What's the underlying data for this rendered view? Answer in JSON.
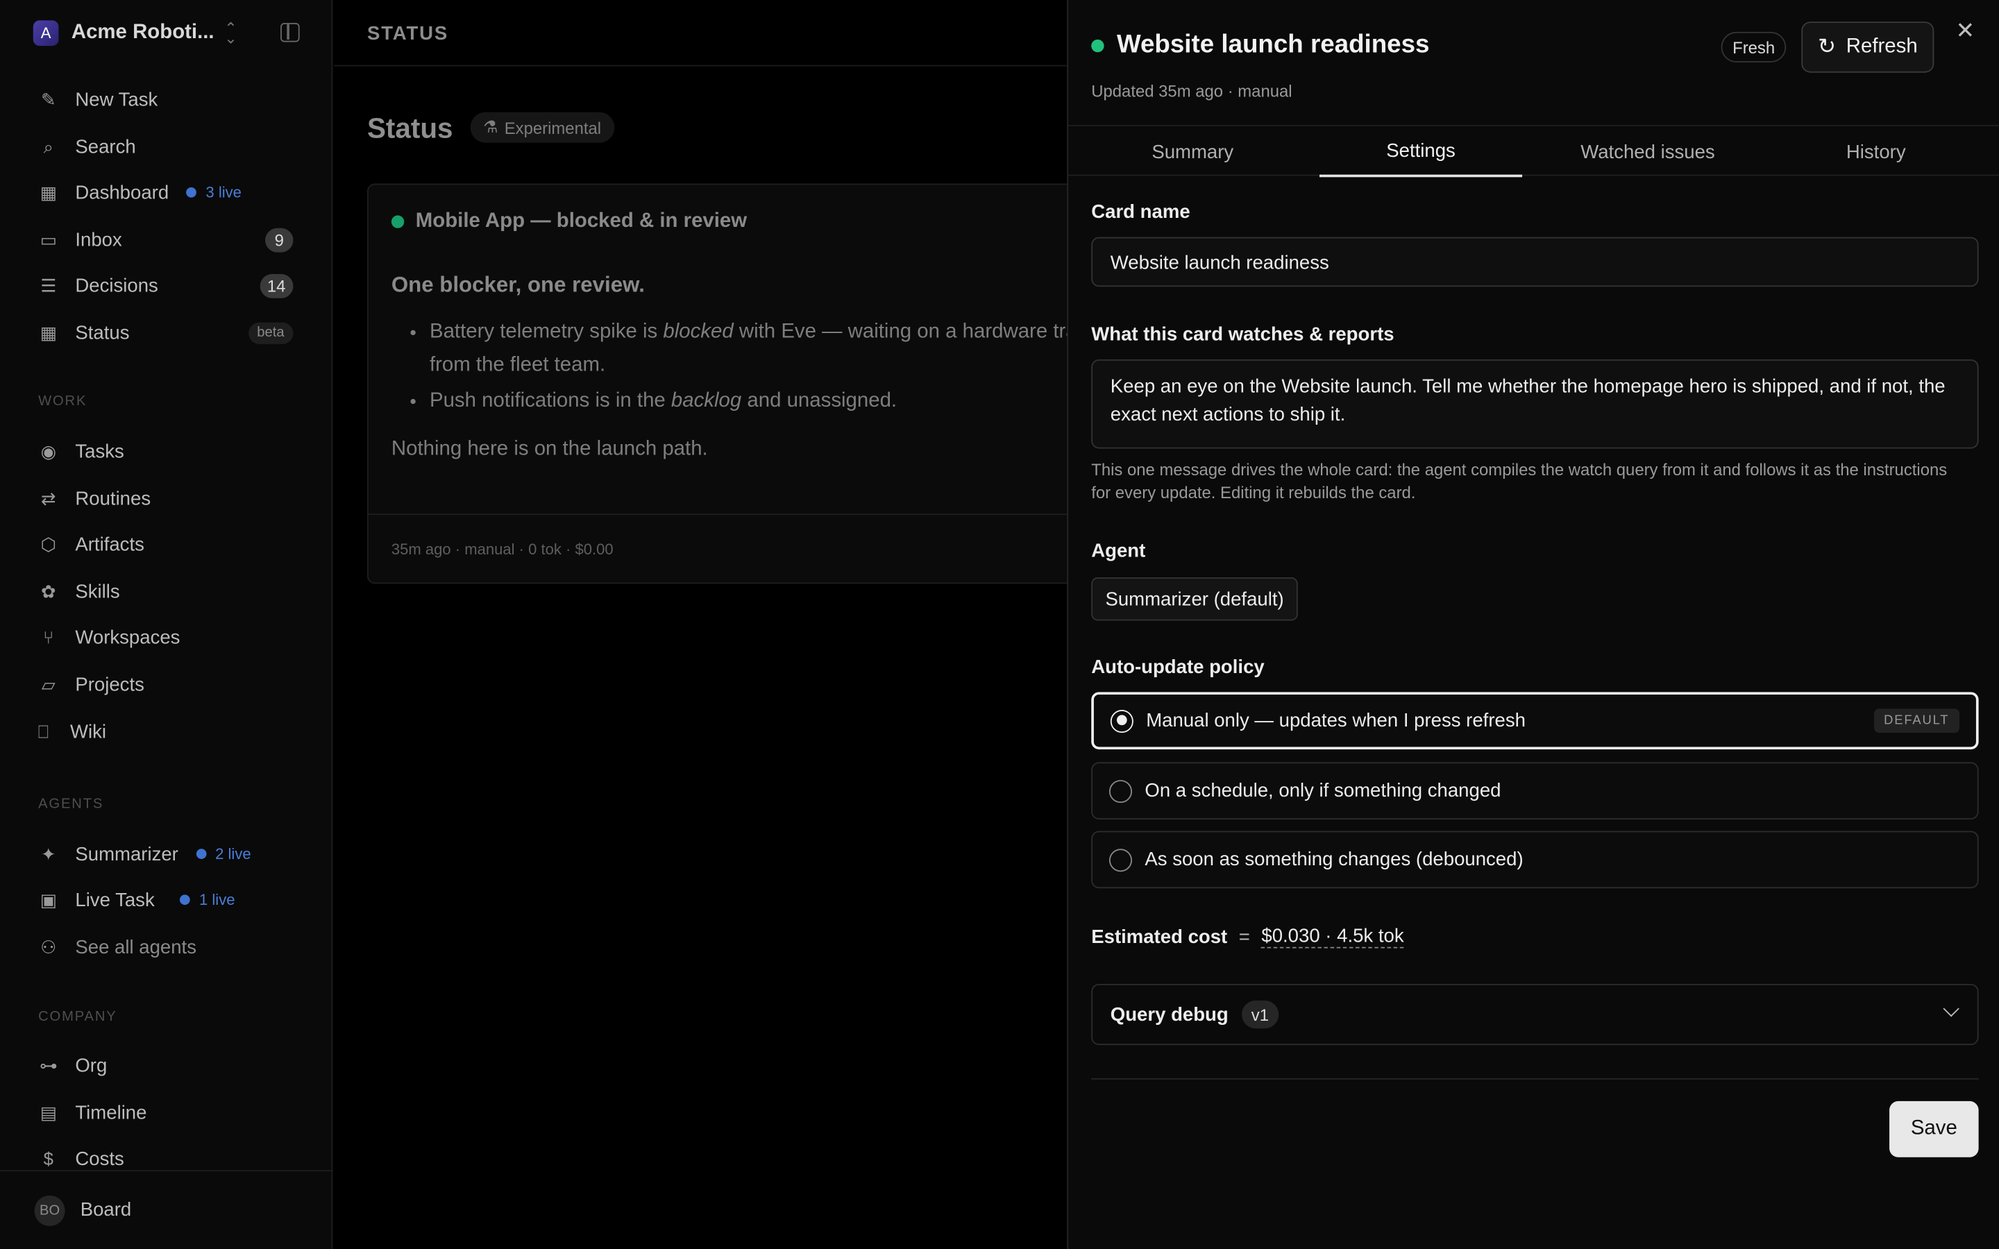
{
  "workspace": {
    "logo": "A",
    "name": "Acme Roboti..."
  },
  "nav": {
    "new_task": "New Task",
    "search": "Search",
    "dashboard": "Dashboard",
    "dashboard_live": "3 live",
    "inbox": "Inbox",
    "inbox_count": "9",
    "decisions": "Decisions",
    "decisions_count": "14",
    "status": "Status",
    "status_badge": "beta"
  },
  "work": {
    "section": "WORK",
    "tasks": "Tasks",
    "routines": "Routines",
    "artifacts": "Artifacts",
    "skills": "Skills",
    "workspaces": "Workspaces",
    "projects": "Projects",
    "wiki": "Wiki"
  },
  "agents": {
    "section": "AGENTS",
    "summarizer": "Summarizer",
    "summarizer_live": "2 live",
    "live_task": "Live Task",
    "live_task_live": "1 live",
    "see_all": "See all agents"
  },
  "company": {
    "section": "COMPANY",
    "org": "Org",
    "timeline": "Timeline",
    "costs": "Costs"
  },
  "footer": {
    "avatar": "BO",
    "name": "Board"
  },
  "main": {
    "breadcrumb": "STATUS",
    "title": "Status",
    "badge": "Experimental",
    "card": {
      "title": "Mobile App — blocked & in review",
      "lead": "One blocker, one review.",
      "bullet1_a": "Battery telemetry spike is ",
      "bullet1_em": "blocked",
      "bullet1_b": " with Eve — waiting on a hardware trace from the fleet team.",
      "bullet2_a": "Push notifications is in the ",
      "bullet2_em": "backlog",
      "bullet2_b": " and unassigned.",
      "closing": "Nothing here is on the launch path.",
      "footer": "35m ago · manual · 0 tok · $0.00"
    }
  },
  "panel": {
    "title": "Website launch readiness",
    "subtitle": "Updated 35m ago · manual",
    "fresh": "Fresh",
    "refresh": "Refresh",
    "tabs": [
      "Summary",
      "Settings",
      "Watched issues",
      "History"
    ],
    "card_name_label": "Card name",
    "card_name_value": "Website launch readiness",
    "watch_label": "What this card watches & reports",
    "watch_value": "Keep an eye on the Website launch. Tell me whether the homepage hero is shipped, and if not, the exact next actions to ship it.",
    "help": "This one message drives the whole card: the agent compiles the watch query from it and follows it as the instructions for every update. Editing it rebuilds the card.",
    "agent_label": "Agent",
    "agent_value": "Summarizer (default)",
    "policy_label": "Auto-update policy",
    "policy_options": [
      "Manual only — updates when I press refresh",
      "On a schedule, only if something changed",
      "As soon as something changes (debounced)"
    ],
    "default_badge": "DEFAULT",
    "cost_label": "Estimated cost",
    "cost_eq": "=",
    "cost_value": "$0.030 · 4.5k tok",
    "debug_label": "Query debug",
    "debug_version": "v1",
    "save": "Save"
  }
}
